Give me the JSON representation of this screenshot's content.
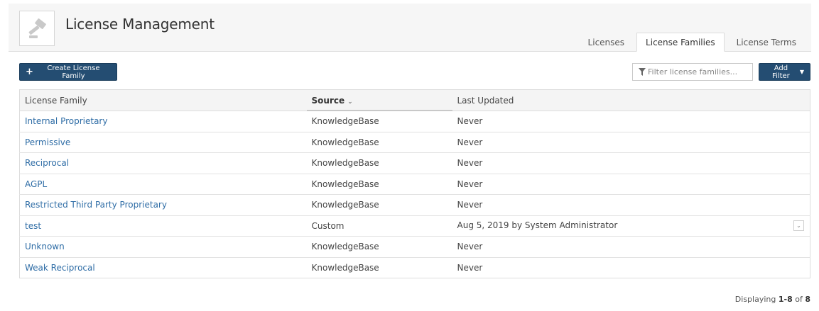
{
  "app": {
    "title": "License Management",
    "icon": "gavel-icon"
  },
  "tabs": [
    {
      "label": "Licenses",
      "active": false
    },
    {
      "label": "License Families",
      "active": true
    },
    {
      "label": "License Terms",
      "active": false
    }
  ],
  "toolbar": {
    "create_label": "Create License Family",
    "filter_placeholder": "Filter license families...",
    "add_filter_label": "Add Filter"
  },
  "table": {
    "columns": [
      {
        "label": "License Family",
        "sorted": false
      },
      {
        "label": "Source",
        "sorted": true
      },
      {
        "label": "Last Updated",
        "sorted": false
      }
    ],
    "rows": [
      {
        "family": "Internal Proprietary",
        "source": "KnowledgeBase",
        "updated": "Never",
        "has_menu": false
      },
      {
        "family": "Permissive",
        "source": "KnowledgeBase",
        "updated": "Never",
        "has_menu": false
      },
      {
        "family": "Reciprocal",
        "source": "KnowledgeBase",
        "updated": "Never",
        "has_menu": false
      },
      {
        "family": "AGPL",
        "source": "KnowledgeBase",
        "updated": "Never",
        "has_menu": false
      },
      {
        "family": "Restricted Third Party Proprietary",
        "source": "KnowledgeBase",
        "updated": "Never",
        "has_menu": false
      },
      {
        "family": "test",
        "source": "Custom",
        "updated": "Aug 5, 2019 by System Administrator",
        "has_menu": true
      },
      {
        "family": "Unknown",
        "source": "KnowledgeBase",
        "updated": "Never",
        "has_menu": false
      },
      {
        "family": "Weak Reciprocal",
        "source": "KnowledgeBase",
        "updated": "Never",
        "has_menu": false
      }
    ]
  },
  "footer": {
    "prefix": "Displaying",
    "range": "1-8",
    "of_label": "of",
    "total": "8"
  },
  "colors": {
    "primary": "#244d72",
    "link": "#2f6da6",
    "header_bg": "#f6f6f6"
  }
}
